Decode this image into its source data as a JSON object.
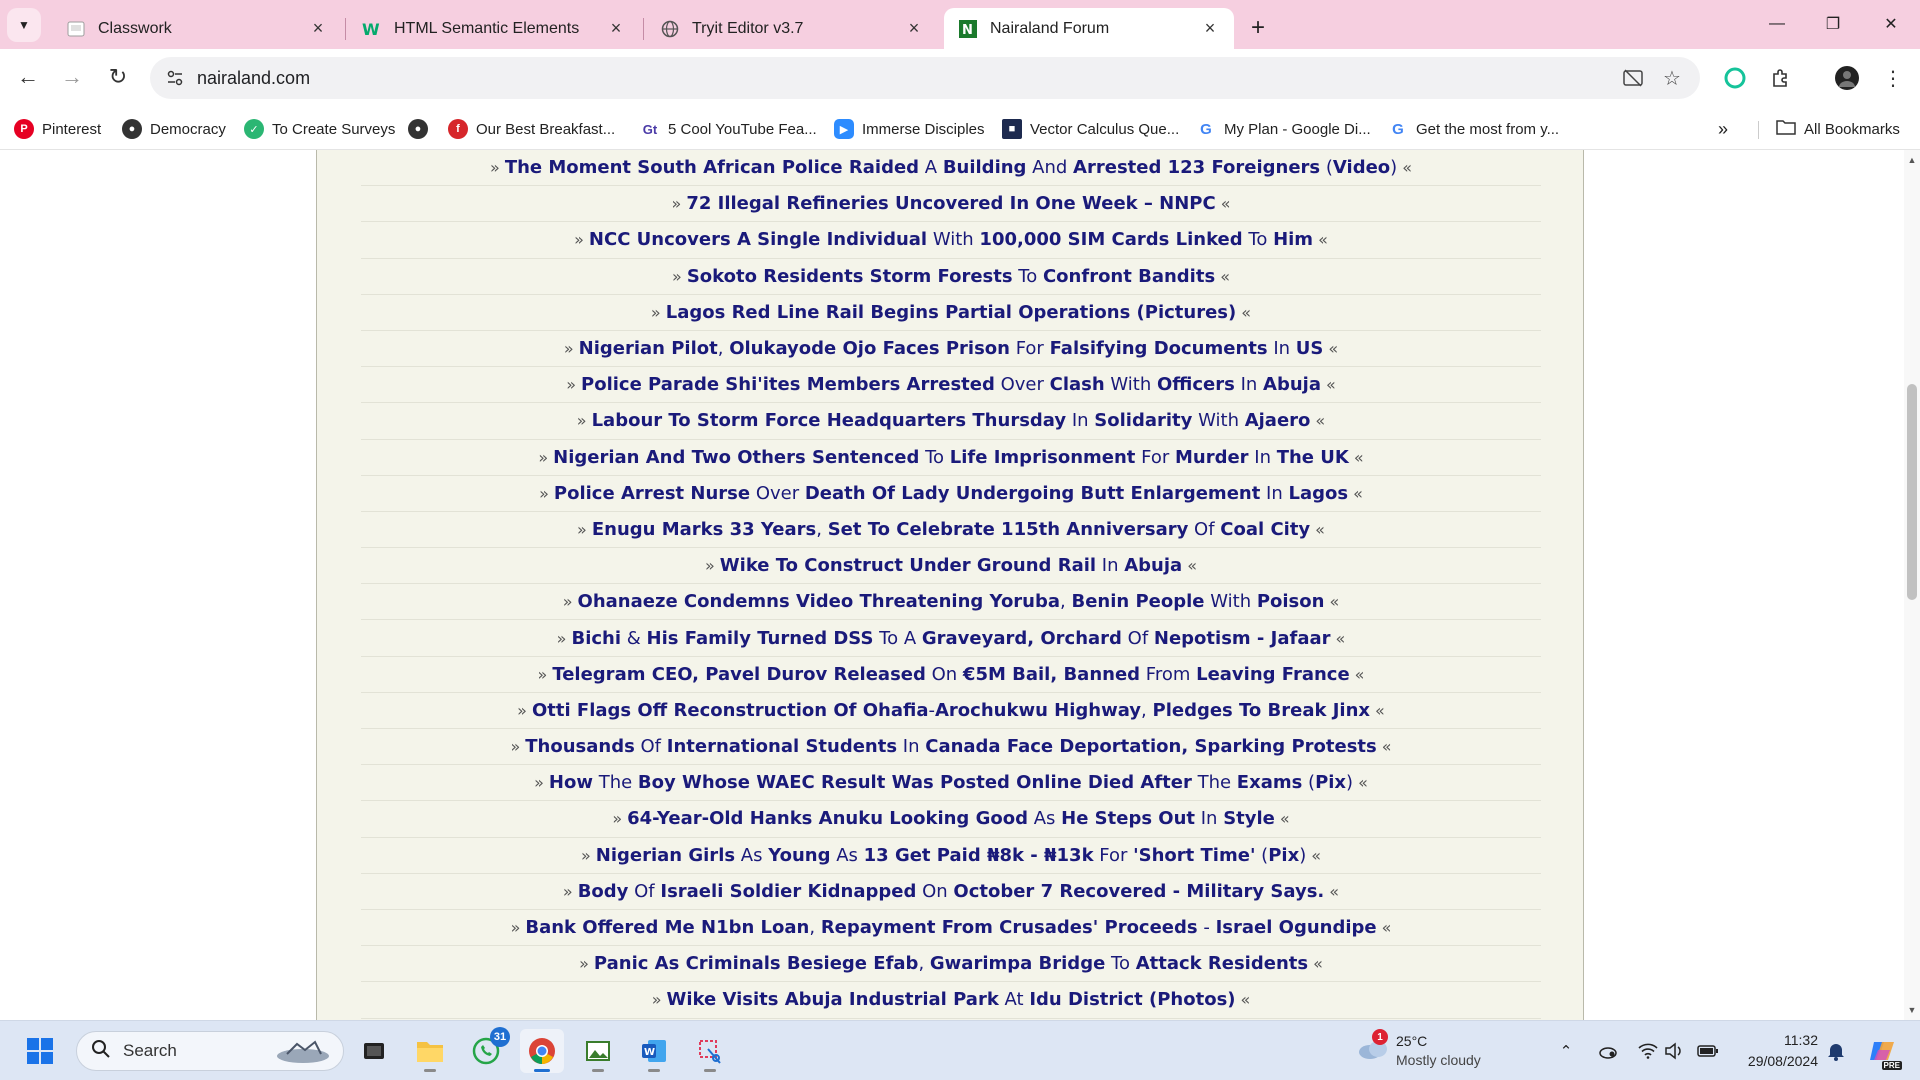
{
  "browser": {
    "tabs": [
      {
        "title": "Classwork",
        "icon": "classroom-icon",
        "active": false
      },
      {
        "title": "HTML Semantic Elements",
        "icon": "w3schools-icon",
        "active": false
      },
      {
        "title": "Tryit Editor v3.7",
        "icon": "globe-icon",
        "active": false
      },
      {
        "title": "Nairaland Forum",
        "icon": "nairaland-icon",
        "active": true
      }
    ],
    "url": "nairaland.com",
    "bookmarks": [
      {
        "label": "Pinterest",
        "icon": "pinterest-icon",
        "color": "#e60023"
      },
      {
        "label": "Democracy",
        "icon": "globe-icon",
        "color": "#333333"
      },
      {
        "label": "To Create Surveys",
        "icon": "survey-icon",
        "color": "#2bb673"
      },
      {
        "label": "",
        "icon": "globe-icon",
        "color": "#333333"
      },
      {
        "label": "Our Best Breakfast...",
        "icon": "food-icon",
        "color": "#d6262b"
      },
      {
        "label": "5 Cool YouTube Fea...",
        "icon": "gt-icon",
        "color": "#4a3aa7"
      },
      {
        "label": "Immerse Disciples",
        "icon": "zoom-icon",
        "color": "#2d8cff"
      },
      {
        "label": "Vector Calculus Que...",
        "icon": "book-icon",
        "color": "#1d2a4f"
      },
      {
        "label": "My Plan - Google Di...",
        "icon": "google-icon",
        "color": "#4285f4"
      },
      {
        "label": "Get the most from y...",
        "icon": "google-icon",
        "color": "#4285f4"
      }
    ],
    "all_bookmarks_label": "All Bookmarks"
  },
  "news": [
    [
      {
        "t": "The Moment South African Police Raided",
        "b": true
      },
      {
        "t": " A ",
        "b": false
      },
      {
        "t": "Building",
        "b": true
      },
      {
        "t": " And ",
        "b": false
      },
      {
        "t": "Arrested 123 Foreigners",
        "b": true
      },
      {
        "t": " (",
        "b": false
      },
      {
        "t": "Video",
        "b": true
      },
      {
        "t": ")",
        "b": false
      }
    ],
    [
      {
        "t": "72 Illegal Refineries Uncovered In One Week – NNPC",
        "b": true
      }
    ],
    [
      {
        "t": "NCC Uncovers A Single Individual",
        "b": true
      },
      {
        "t": " With ",
        "b": false
      },
      {
        "t": "100,000 SIM Cards Linked",
        "b": true
      },
      {
        "t": " To ",
        "b": false
      },
      {
        "t": "Him",
        "b": true
      }
    ],
    [
      {
        "t": "Sokoto Residents Storm Forests",
        "b": true
      },
      {
        "t": " To ",
        "b": false
      },
      {
        "t": "Confront Bandits",
        "b": true
      }
    ],
    [
      {
        "t": "Lagos Red Line Rail Begins Partial Operations (Pictures)",
        "b": true
      }
    ],
    [
      {
        "t": "Nigerian Pilot",
        "b": true
      },
      {
        "t": ", ",
        "b": false
      },
      {
        "t": "Olukayode Ojo Faces Prison",
        "b": true
      },
      {
        "t": " For ",
        "b": false
      },
      {
        "t": "Falsifying Documents",
        "b": true
      },
      {
        "t": " In ",
        "b": false
      },
      {
        "t": "US",
        "b": true
      }
    ],
    [
      {
        "t": "Police Parade Shi'ites Members Arrested",
        "b": true
      },
      {
        "t": " Over ",
        "b": false
      },
      {
        "t": "Clash",
        "b": true
      },
      {
        "t": " With ",
        "b": false
      },
      {
        "t": "Officers",
        "b": true
      },
      {
        "t": " In ",
        "b": false
      },
      {
        "t": "Abuja",
        "b": true
      }
    ],
    [
      {
        "t": "Labour To Storm Force Headquarters Thursday",
        "b": true
      },
      {
        "t": " In ",
        "b": false
      },
      {
        "t": "Solidarity",
        "b": true
      },
      {
        "t": " With ",
        "b": false
      },
      {
        "t": "Ajaero",
        "b": true
      }
    ],
    [
      {
        "t": "Nigerian And Two Others Sentenced",
        "b": true
      },
      {
        "t": " To ",
        "b": false
      },
      {
        "t": "Life Imprisonment",
        "b": true
      },
      {
        "t": " For ",
        "b": false
      },
      {
        "t": "Murder",
        "b": true
      },
      {
        "t": " In ",
        "b": false
      },
      {
        "t": "The UK",
        "b": true
      }
    ],
    [
      {
        "t": "Police Arrest Nurse",
        "b": true
      },
      {
        "t": " Over ",
        "b": false
      },
      {
        "t": "Death Of Lady Undergoing Butt Enlargement",
        "b": true
      },
      {
        "t": " In ",
        "b": false
      },
      {
        "t": "Lagos",
        "b": true
      }
    ],
    [
      {
        "t": "Enugu Marks 33 Years",
        "b": true
      },
      {
        "t": ", ",
        "b": false
      },
      {
        "t": "Set To Celebrate 115th Anniversary",
        "b": true
      },
      {
        "t": " Of ",
        "b": false
      },
      {
        "t": "Coal City",
        "b": true
      }
    ],
    [
      {
        "t": "Wike To Construct Under Ground Rail",
        "b": true
      },
      {
        "t": " In ",
        "b": false
      },
      {
        "t": "Abuja",
        "b": true
      }
    ],
    [
      {
        "t": "Ohanaeze Condemns Video Threatening Yoruba",
        "b": true
      },
      {
        "t": ", ",
        "b": false
      },
      {
        "t": "Benin People",
        "b": true
      },
      {
        "t": " With ",
        "b": false
      },
      {
        "t": "Poison",
        "b": true
      }
    ],
    [
      {
        "t": "Bichi",
        "b": true
      },
      {
        "t": " & ",
        "b": false
      },
      {
        "t": "His Family Turned DSS",
        "b": true
      },
      {
        "t": " To A ",
        "b": false
      },
      {
        "t": "Graveyard, Orchard",
        "b": true
      },
      {
        "t": " Of ",
        "b": false
      },
      {
        "t": "Nepotism - Jafaar",
        "b": true
      }
    ],
    [
      {
        "t": "Telegram CEO, Pavel Durov Released",
        "b": true
      },
      {
        "t": " On ",
        "b": false
      },
      {
        "t": "€5M Bail, Banned",
        "b": true
      },
      {
        "t": " From ",
        "b": false
      },
      {
        "t": "Leaving France",
        "b": true
      }
    ],
    [
      {
        "t": "Otti Flags Off Reconstruction Of Ohafia",
        "b": true
      },
      {
        "t": "-",
        "b": false
      },
      {
        "t": "Arochukwu Highway",
        "b": true
      },
      {
        "t": ", ",
        "b": false
      },
      {
        "t": "Pledges To Break Jinx",
        "b": true
      }
    ],
    [
      {
        "t": "Thousands",
        "b": true
      },
      {
        "t": " Of ",
        "b": false
      },
      {
        "t": "International Students",
        "b": true
      },
      {
        "t": " In ",
        "b": false
      },
      {
        "t": "Canada Face Deportation, Sparking Protests",
        "b": true
      }
    ],
    [
      {
        "t": "How",
        "b": true
      },
      {
        "t": " The ",
        "b": false
      },
      {
        "t": "Boy Whose WAEC Result Was Posted Online Died After",
        "b": true
      },
      {
        "t": " The ",
        "b": false
      },
      {
        "t": "Exams",
        "b": true
      },
      {
        "t": " (",
        "b": false
      },
      {
        "t": "Pix",
        "b": true
      },
      {
        "t": ")",
        "b": false
      }
    ],
    [
      {
        "t": "64-Year-Old Hanks Anuku Looking Good",
        "b": true
      },
      {
        "t": " As ",
        "b": false
      },
      {
        "t": "He Steps Out",
        "b": true
      },
      {
        "t": " In ",
        "b": false
      },
      {
        "t": "Style",
        "b": true
      }
    ],
    [
      {
        "t": "Nigerian Girls",
        "b": true
      },
      {
        "t": " As ",
        "b": false
      },
      {
        "t": "Young",
        "b": true
      },
      {
        "t": " As ",
        "b": false
      },
      {
        "t": "13 Get Paid ₦8k - ₦13k",
        "b": true
      },
      {
        "t": " For ",
        "b": false
      },
      {
        "t": "'Short Time'",
        "b": true
      },
      {
        "t": " (",
        "b": false
      },
      {
        "t": "Pix",
        "b": true
      },
      {
        "t": ")",
        "b": false
      }
    ],
    [
      {
        "t": "Body",
        "b": true
      },
      {
        "t": " Of ",
        "b": false
      },
      {
        "t": "Israeli Soldier Kidnapped",
        "b": true
      },
      {
        "t": " On ",
        "b": false
      },
      {
        "t": "October 7 Recovered - Military Says.",
        "b": true
      }
    ],
    [
      {
        "t": "Bank Offered Me N1bn Loan",
        "b": true
      },
      {
        "t": ", ",
        "b": false
      },
      {
        "t": "Repayment From Crusades' Proceeds",
        "b": true
      },
      {
        "t": " - ",
        "b": false
      },
      {
        "t": "Israel Ogundipe",
        "b": true
      }
    ],
    [
      {
        "t": "Panic As Criminals Besiege Efab",
        "b": true
      },
      {
        "t": ", ",
        "b": false
      },
      {
        "t": "Gwarimpa Bridge",
        "b": true
      },
      {
        "t": " To ",
        "b": false
      },
      {
        "t": "Attack Residents",
        "b": true
      }
    ],
    [
      {
        "t": "Wike Visits Abuja Industrial Park",
        "b": true
      },
      {
        "t": " At ",
        "b": false
      },
      {
        "t": "Idu District (Photos)",
        "b": true
      }
    ]
  ],
  "news_prefix": "»",
  "news_suffix": "«",
  "taskbar": {
    "search_label": "Search",
    "whatsapp_badge": "31",
    "weather_temp": "25°C",
    "weather_cond": "Mostly cloudy",
    "weather_badge": "1",
    "time": "11:32",
    "date": "29/08/2024",
    "copilot_label": "PRE"
  },
  "colors": {
    "tabstrip": "#f6cfe0",
    "panel_bg": "#f4f4ea",
    "link": "#1a1a7a",
    "taskbar": "#dde6f4"
  }
}
